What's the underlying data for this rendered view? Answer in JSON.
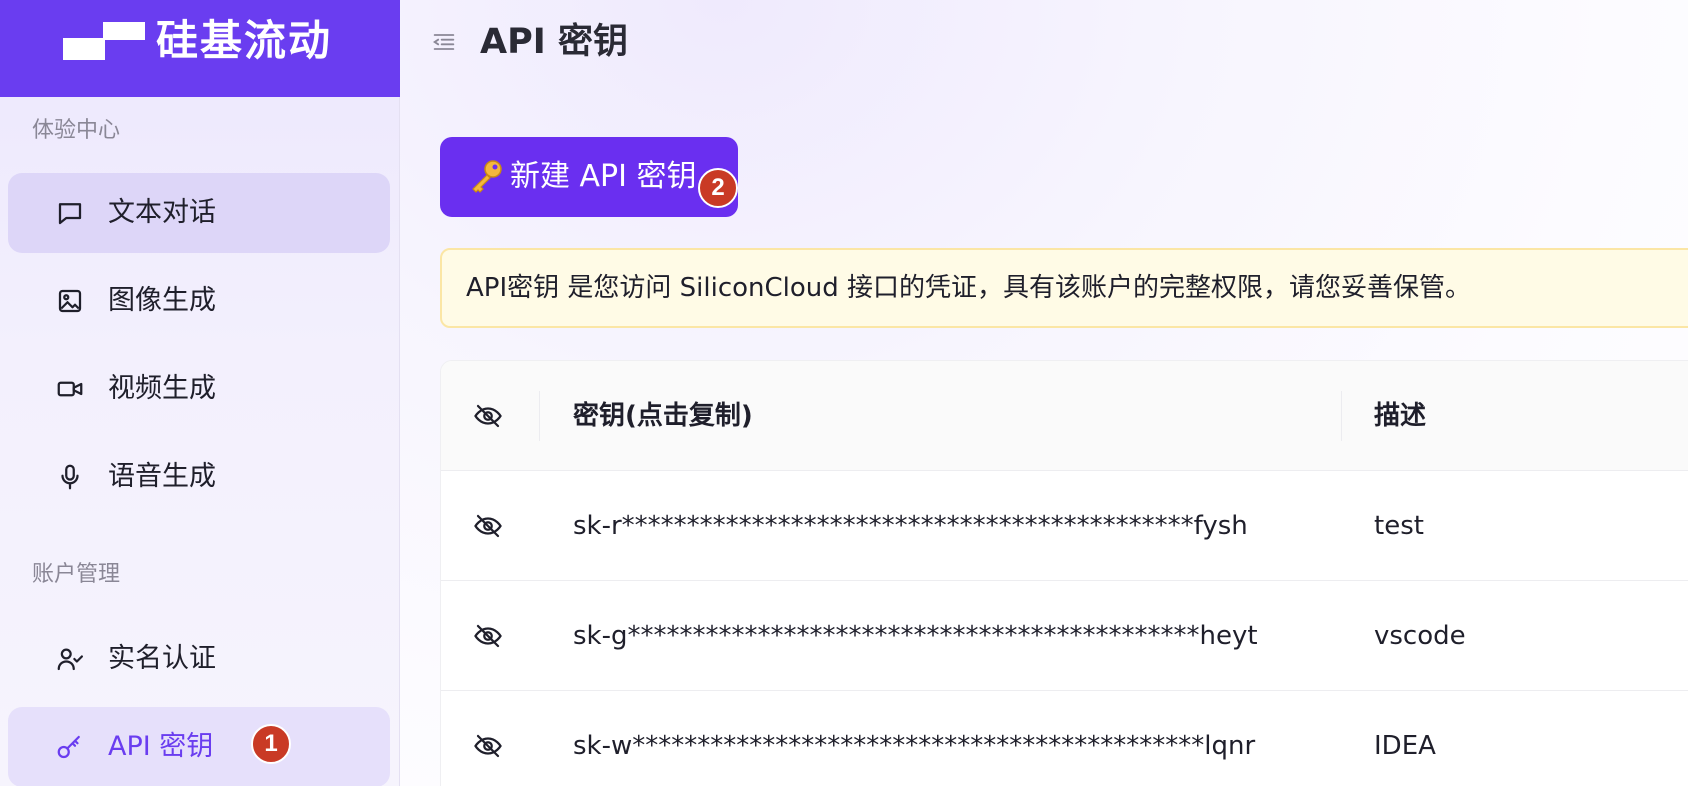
{
  "brand": {
    "name": "硅基流动",
    "color": "#6a3df0"
  },
  "sidebar": {
    "sections": [
      {
        "label": "体验中心",
        "items": [
          {
            "label": "文本对话",
            "icon": "chat-icon"
          },
          {
            "label": "图像生成",
            "icon": "image-icon"
          },
          {
            "label": "视频生成",
            "icon": "video-icon"
          },
          {
            "label": "语音生成",
            "icon": "microphone-icon"
          }
        ]
      },
      {
        "label": "账户管理",
        "items": [
          {
            "label": "实名认证",
            "icon": "user-check-icon"
          },
          {
            "label": "API 密钥",
            "icon": "key-icon",
            "active": true
          }
        ]
      }
    ]
  },
  "header": {
    "title": "API 密钥"
  },
  "main": {
    "new_key_button": "新建 API 密钥",
    "notice": "API密钥 是您访问 SiliconCloud 接口的凭证，具有该账户的完整权限，请您妥善保管。",
    "table": {
      "columns": [
        "密钥(点击复制)",
        "描述"
      ],
      "rows": [
        {
          "key": "sk-r********************************************fysh",
          "description": "test"
        },
        {
          "key": "sk-g********************************************heyt",
          "description": "vscode"
        },
        {
          "key": "sk-w********************************************lqnr",
          "description": "IDEA"
        }
      ]
    }
  },
  "annotations": {
    "badge_1": "1",
    "badge_2": "2",
    "badge_color": "#c93a25"
  }
}
